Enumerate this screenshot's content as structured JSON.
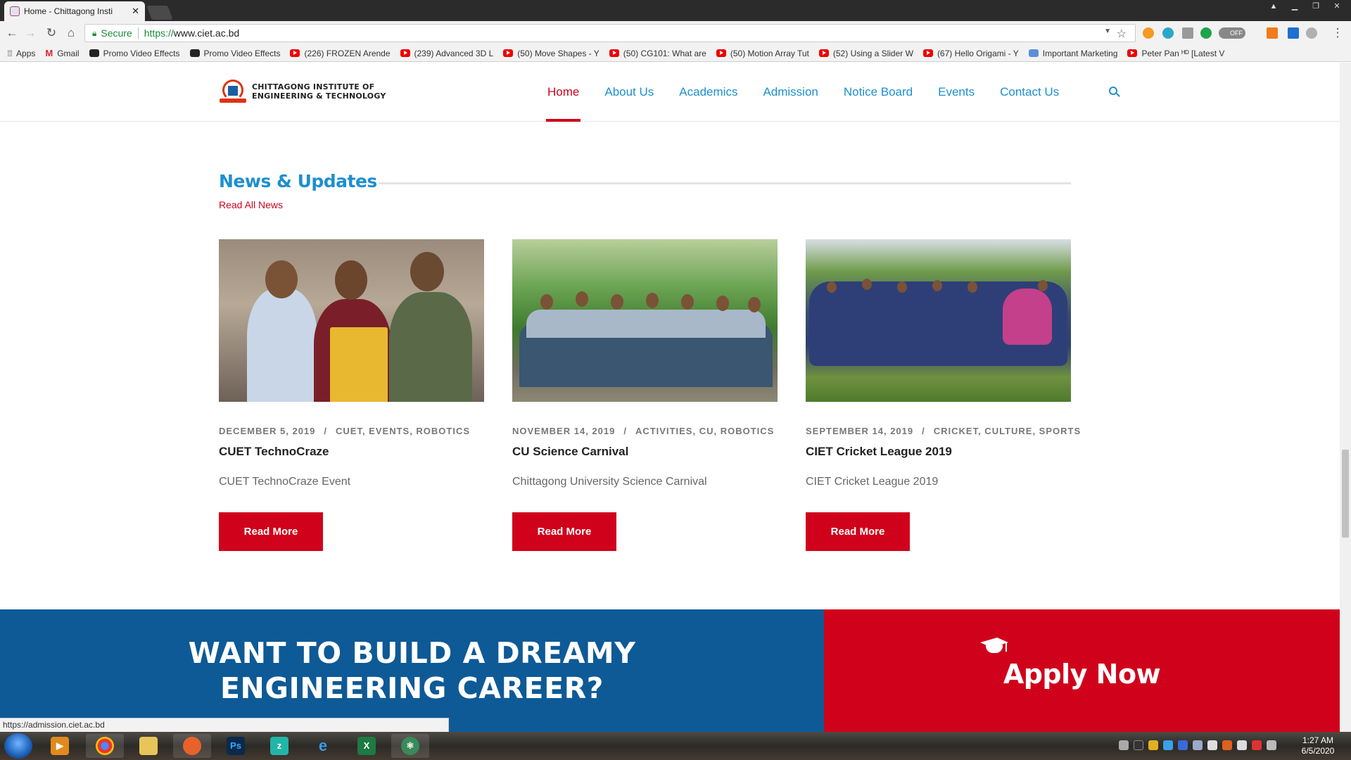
{
  "browser": {
    "tab_title": "Home - Chittagong Insti",
    "tab_close": "✕",
    "secure_label": "Secure",
    "url_scheme": "https://",
    "url_host": "www.ciet.ac.bd",
    "toggle_label": "OFF",
    "bookmarks": [
      {
        "label": "Apps",
        "icon": "apps-grid-icon"
      },
      {
        "label": "Gmail",
        "icon": "gmail-icon"
      },
      {
        "label": "Promo Video Effects",
        "icon": "promo-video-icon"
      },
      {
        "label": "Promo Video Effects",
        "icon": "promo-video-icon"
      },
      {
        "label": "(226) FROZEN Arende",
        "icon": "youtube-icon"
      },
      {
        "label": "(239) Advanced 3D L",
        "icon": "youtube-icon"
      },
      {
        "label": "(50) Move Shapes - Y",
        "icon": "youtube-icon"
      },
      {
        "label": "(50) CG101: What are",
        "icon": "youtube-icon"
      },
      {
        "label": "(50) Motion Array Tut",
        "icon": "youtube-icon"
      },
      {
        "label": "(52) Using a Slider W",
        "icon": "youtube-icon"
      },
      {
        "label": "(67) Hello Origami - Y",
        "icon": "youtube-icon"
      },
      {
        "label": "Important Marketing",
        "icon": "marketing-icon"
      },
      {
        "label": "Peter Pan ᴴᴰ [Latest V",
        "icon": "youtube-icon"
      }
    ],
    "status_url": "https://admission.ciet.ac.bd"
  },
  "site": {
    "logo_line1": "CHITTAGONG INSTITUTE OF",
    "logo_line2": "ENGINEERING & TECHNOLOGY",
    "nav": [
      {
        "label": "Home",
        "active": true
      },
      {
        "label": "About Us"
      },
      {
        "label": "Academics"
      },
      {
        "label": "Admission"
      },
      {
        "label": "Notice Board"
      },
      {
        "label": "Events"
      },
      {
        "label": "Contact Us"
      }
    ],
    "news": {
      "title": "News & Updates",
      "read_all": "Read All News",
      "cards": [
        {
          "date": "DECEMBER 5, 2019",
          "categories": "CUET, EVENTS, ROBOTICS",
          "title": "CUET TechnoCraze",
          "excerpt": "CUET TechnoCraze Event",
          "button": "Read More"
        },
        {
          "date": "NOVEMBER 14, 2019",
          "categories": "ACTIVITIES, CU, ROBOTICS",
          "title": "CU Science Carnival",
          "excerpt": "Chittagong University Science Carnival",
          "button": "Read More"
        },
        {
          "date": "SEPTEMBER 14, 2019",
          "categories": "CRICKET, CULTURE, SPORTS",
          "title": "CIET Cricket League 2019",
          "excerpt": "CIET Cricket League 2019",
          "button": "Read More"
        }
      ],
      "meta_separator": "/"
    },
    "cta": {
      "line1": "WANT TO BUILD A DREAMY",
      "line2": "ENGINEERING CAREER?",
      "apply": "Apply Now"
    }
  },
  "taskbar": {
    "time": "1:27 AM",
    "date": "6/5/2020"
  },
  "colors": {
    "brand_red": "#d0021b",
    "brand_blue": "#1d8fcf",
    "cta_blue": "#0e5a96"
  }
}
